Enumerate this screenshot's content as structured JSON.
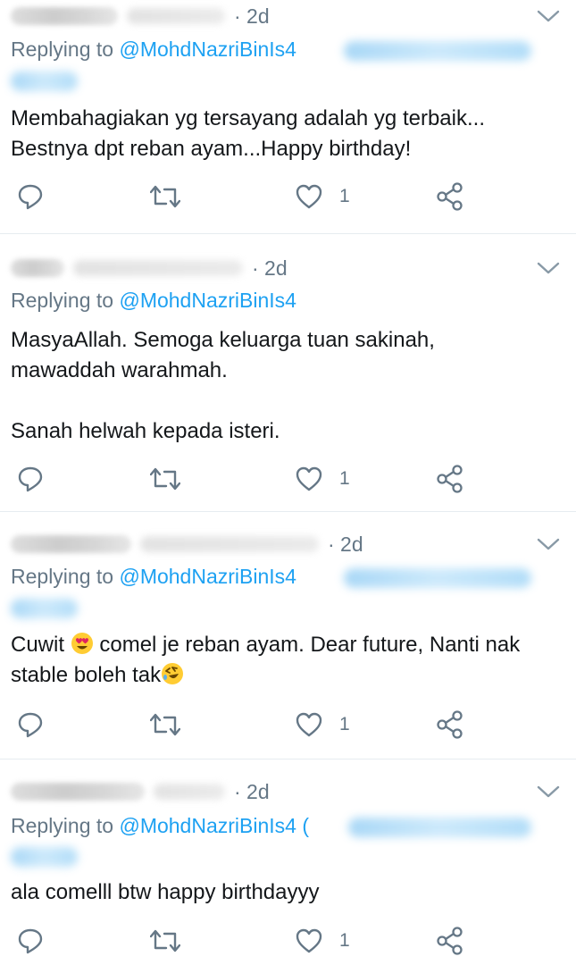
{
  "replies": [
    {
      "time": "· 2d",
      "replying_prefix": "Replying to ",
      "replying_handle": "@MohdNazriBinIs4",
      "text": "Membahagiakan yg tersayang adalah yg terbaik...\nBestnya dpt reban ayam...Happy birthday!",
      "like_count": "1"
    },
    {
      "time": "· 2d",
      "replying_prefix": "Replying to ",
      "replying_handle": "@MohdNazriBinIs4",
      "text": "MasyaAllah. Semoga keluarga tuan sakinah,\nmawaddah warahmah.\n\nSanah helwah kepada isteri.",
      "like_count": "1"
    },
    {
      "time": "· 2d",
      "replying_prefix": "Replying to ",
      "replying_handle": "@MohdNazriBinIs4",
      "text_part1": "Cuwit ",
      "text_emoji1": "smiling-face-with-heart-eyes",
      "text_part2": " comel je reban ayam. Dear future, Nanti nak\nstable boleh tak",
      "text_emoji2": "rolling-on-floor-laughing",
      "like_count": "1"
    },
    {
      "time": "· 2d",
      "replying_prefix": "Replying to ",
      "replying_handle": "@MohdNazriBinIs4",
      "replying_suffix": " (",
      "text": "ala comelll btw happy birthdayyy",
      "like_count": "1"
    }
  ],
  "colors": {
    "link": "#1da1f2",
    "muted": "#657786",
    "text": "#14171a",
    "divider": "#e6ecf0"
  },
  "icons": [
    "chevron-down-icon",
    "reply-icon",
    "retweet-icon",
    "like-icon",
    "share-icon"
  ]
}
